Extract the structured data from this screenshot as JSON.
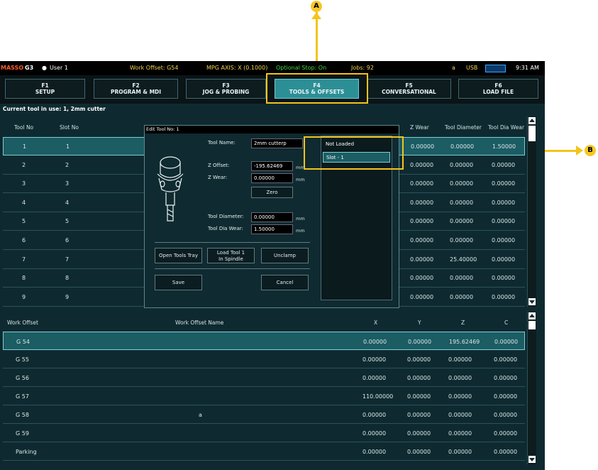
{
  "statusbar": {
    "brand": "MASSO",
    "model": "G3",
    "user": "User 1",
    "work_offset": "Work Offset: G54",
    "mpg_axis": "MPG AXIS: X (0.1000)",
    "optional_stop": "Optional Stop: On",
    "jobs": "Jobs: 92",
    "a_label": "a",
    "usb": "USB",
    "time": "9:31 AM"
  },
  "fkeys": [
    {
      "key": "F1",
      "label": "SETUP"
    },
    {
      "key": "F2",
      "label": "PROGRAM & MDI"
    },
    {
      "key": "F3",
      "label": "JOG & PROBING"
    },
    {
      "key": "F4",
      "label": "TOOLS & OFFSETS"
    },
    {
      "key": "F5",
      "label": "CONVERSATIONAL"
    },
    {
      "key": "F6",
      "label": "LOAD FILE"
    }
  ],
  "current_tool": "Current tool in use: 1, 2mm cutter",
  "tool_table": {
    "headers": {
      "tool_no": "Tool No",
      "slot_no": "Slot No",
      "z_wear": "Z Wear",
      "tool_diameter": "Tool Diameter",
      "tool_dia_wear": "Tool Dia Wear"
    },
    "rows": [
      {
        "tool": "1",
        "slot": "1",
        "z_wear": "0.00000",
        "dia": "0.00000",
        "dia_wear": "1.50000"
      },
      {
        "tool": "2",
        "slot": "2",
        "z_wear": "0.00000",
        "dia": "0.00000",
        "dia_wear": "0.00000"
      },
      {
        "tool": "3",
        "slot": "3",
        "z_wear": "0.00000",
        "dia": "0.00000",
        "dia_wear": "0.00000"
      },
      {
        "tool": "4",
        "slot": "4",
        "z_wear": "0.00000",
        "dia": "0.00000",
        "dia_wear": "0.00000"
      },
      {
        "tool": "5",
        "slot": "5",
        "z_wear": "0.00000",
        "dia": "0.00000",
        "dia_wear": "0.00000"
      },
      {
        "tool": "6",
        "slot": "6",
        "z_wear": "0.00000",
        "dia": "0.00000",
        "dia_wear": "0.00000"
      },
      {
        "tool": "7",
        "slot": "7",
        "z_wear": "0.00000",
        "dia": "25.40000",
        "dia_wear": "0.00000"
      },
      {
        "tool": "8",
        "slot": "8",
        "z_wear": "0.00000",
        "dia": "0.00000",
        "dia_wear": "0.00000"
      },
      {
        "tool": "9",
        "slot": "9",
        "z_wear": "0.00000",
        "dia": "0.00000",
        "dia_wear": "0.00000"
      }
    ]
  },
  "dialog": {
    "title": "Edit Tool No: 1",
    "tool_name_label": "Tool Name:",
    "tool_name_value": "2mm cutterp",
    "z_offset_label": "Z Offset:",
    "z_offset_value": "-195.62469",
    "z_wear_label": "Z Wear:",
    "z_wear_value": "0.00000",
    "unit": "mm",
    "zero_btn": "Zero",
    "tool_diameter_label": "Tool Diameter:",
    "tool_diameter_value": "0.00000",
    "tool_dia_wear_label": "Tool Dia Wear:",
    "tool_dia_wear_value": "1.50000",
    "open_tray_btn": "Open Tools Tray",
    "load_tool_btn_1": "Load Tool 1",
    "load_tool_btn_2": "In Spindle",
    "unclamp_btn": "Unclamp",
    "save_btn": "Save",
    "cancel_btn": "Cancel",
    "slots": [
      "Not Loaded",
      "Slot - 1"
    ]
  },
  "offset_table": {
    "headers": {
      "work_offset": "Work Offset",
      "name": "Work Offset Name",
      "x": "X",
      "y": "Y",
      "z": "Z",
      "c": "C"
    },
    "rows": [
      {
        "offset": "G 54",
        "name": "",
        "x": "0.00000",
        "y": "0.00000",
        "z": "195.62469",
        "c": "0.00000"
      },
      {
        "offset": "G 55",
        "name": "",
        "x": "0.00000",
        "y": "0.00000",
        "z": "0.00000",
        "c": "0.00000"
      },
      {
        "offset": "G 56",
        "name": "",
        "x": "0.00000",
        "y": "0.00000",
        "z": "0.00000",
        "c": "0.00000"
      },
      {
        "offset": "G 57",
        "name": "",
        "x": "110.00000",
        "y": "0.00000",
        "z": "0.00000",
        "c": "0.00000"
      },
      {
        "offset": "G 58",
        "name": "a",
        "x": "0.00000",
        "y": "0.00000",
        "z": "0.00000",
        "c": "0.00000"
      },
      {
        "offset": "G 59",
        "name": "",
        "x": "0.00000",
        "y": "0.00000",
        "z": "0.00000",
        "c": "0.00000"
      },
      {
        "offset": "Parking",
        "name": "",
        "x": "0.00000",
        "y": "0.00000",
        "z": "0.00000",
        "c": "0.00000"
      }
    ]
  },
  "annotations": {
    "a": "A",
    "b": "B"
  },
  "colors": {
    "accent": "#2d8f96",
    "callout": "#f3c51b",
    "optional_stop": "#3fdc3f",
    "status_yellow": "#f0d24a"
  }
}
